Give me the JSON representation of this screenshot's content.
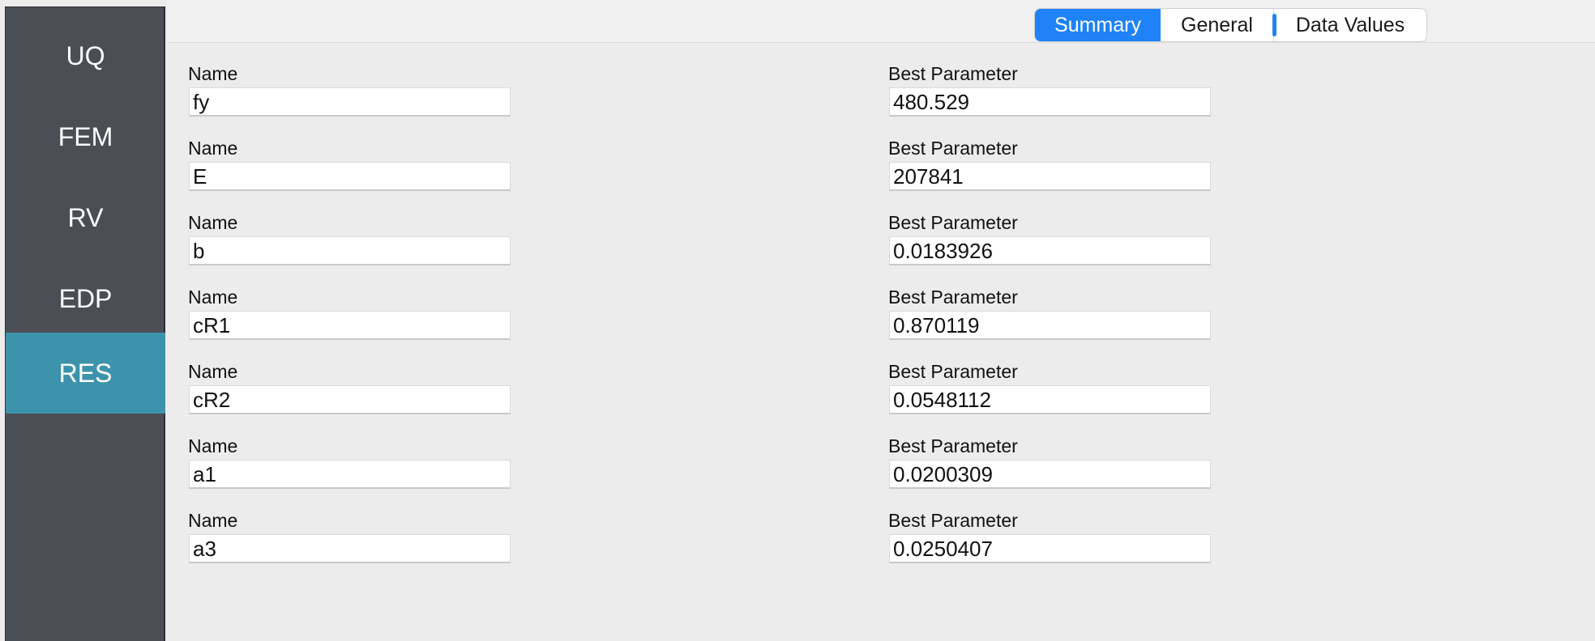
{
  "sidebar": {
    "items": [
      {
        "label": "UQ"
      },
      {
        "label": "FEM"
      },
      {
        "label": "RV"
      },
      {
        "label": "EDP"
      },
      {
        "label": "RES"
      }
    ],
    "active": "RES"
  },
  "tabs": [
    {
      "label": "Summary"
    },
    {
      "label": "General"
    },
    {
      "label": "Data Values"
    }
  ],
  "active_tab": "Summary",
  "results": {
    "name_label": "Name",
    "value_label": "Best Parameter",
    "rows": [
      {
        "name": "fy",
        "value": "480.529"
      },
      {
        "name": "E",
        "value": "207841"
      },
      {
        "name": "b",
        "value": "0.0183926"
      },
      {
        "name": "cR1",
        "value": "0.870119"
      },
      {
        "name": "cR2",
        "value": "0.0548112"
      },
      {
        "name": "a1",
        "value": "0.0200309"
      },
      {
        "name": "a3",
        "value": "0.0250407"
      }
    ]
  },
  "colors": {
    "sidebar_bg": "#4b4e55",
    "sidebar_active": "#3d93ab",
    "tab_active": "#1f82f7",
    "content_bg": "#ececec"
  }
}
